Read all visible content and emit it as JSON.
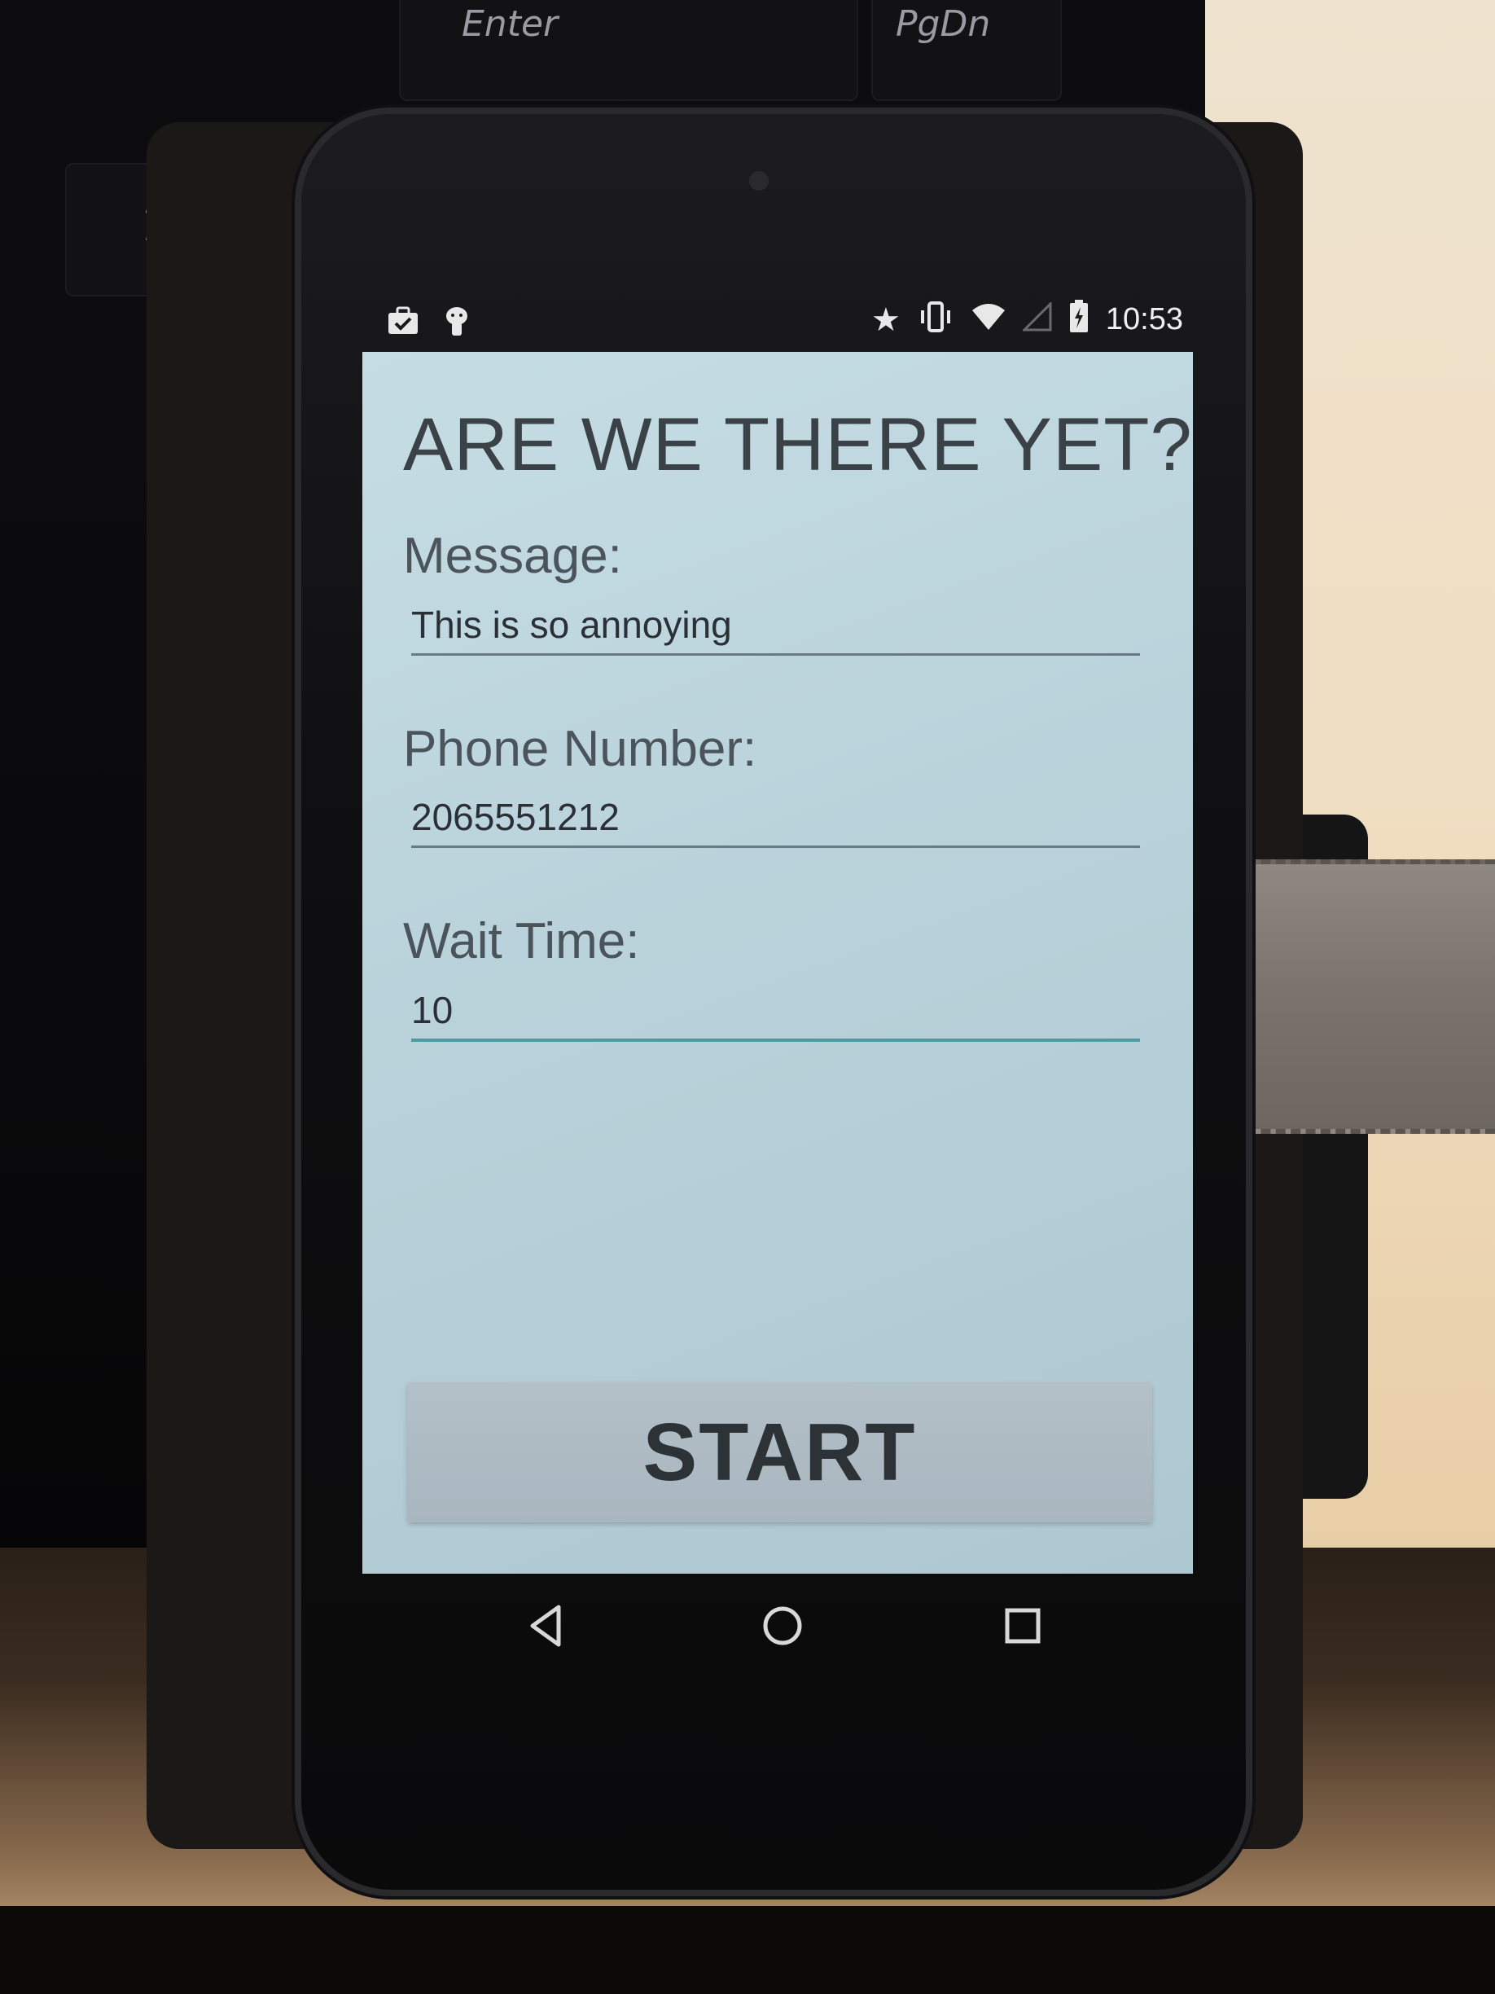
{
  "background": {
    "keys": {
      "enter_label": "Enter",
      "pgdn_label": "PgDn",
      "question_label": "?"
    }
  },
  "status_bar": {
    "left_icons": [
      "briefcase-check-icon",
      "android-debug-icon"
    ],
    "right_icons": [
      "star-icon",
      "vibrate-icon",
      "wifi-icon",
      "signal-icon",
      "battery-charging-icon"
    ],
    "time": "10:53"
  },
  "app": {
    "title": "ARE WE THERE YET?",
    "fields": {
      "message": {
        "label": "Message:",
        "value": "This is so annoying"
      },
      "phone": {
        "label": "Phone Number:",
        "value": "2065551212"
      },
      "wait": {
        "label": "Wait Time:",
        "value": "10"
      }
    },
    "start_button_label": "START"
  },
  "nav_bar": {
    "buttons": [
      "back-icon",
      "home-icon",
      "recents-icon"
    ]
  },
  "colors": {
    "screen_background": "#bcd4dc",
    "text": "#3a4248",
    "active_underline": "#4f9aa0",
    "button": "#aebbc4"
  }
}
